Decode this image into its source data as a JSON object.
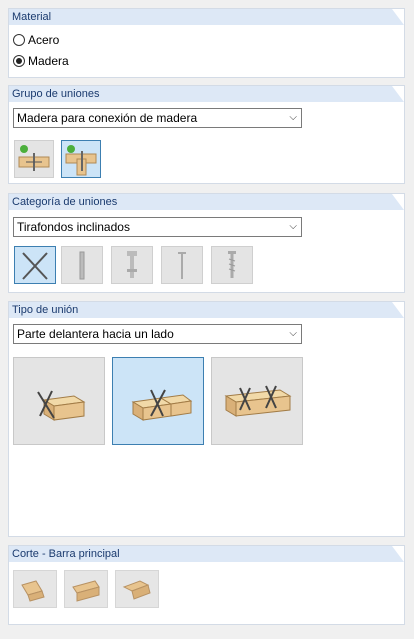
{
  "material": {
    "header": "Material",
    "options": [
      {
        "label": "Acero",
        "checked": false
      },
      {
        "label": "Madera",
        "checked": true
      }
    ]
  },
  "grupo": {
    "header": "Grupo de uniones",
    "selected": "Madera para conexión de madera",
    "icons": [
      "timber-to-timber-connection-icon",
      "timber-to-timber-cross-connection-icon"
    ],
    "selected_index": 1
  },
  "categoria": {
    "header": "Categoría de uniones",
    "selected": "Tirafondos inclinados",
    "icons": [
      "inclined-screws-icon",
      "dowel-icon",
      "bolt-icon",
      "nail-icon",
      "screw-icon"
    ],
    "selected_index": 0
  },
  "tipo": {
    "header": "Tipo de unión",
    "selected": "Parte delantera hacia un lado",
    "icons": [
      "end-joint-one-side-icon",
      "t-joint-crossed-screws-icon",
      "beam-joint-screws-icon"
    ],
    "selected_index": 1
  },
  "corte": {
    "header": "Corte - Barra principal",
    "icons": [
      "cut-variant-1-icon",
      "cut-variant-2-icon",
      "cut-variant-3-icon"
    ]
  },
  "colors": {
    "header_bg": "#dde8f6",
    "header_text": "#1a3a6e",
    "selected_bg": "#cce4f7",
    "selected_border": "#3c7fb1",
    "wood": "#e8c48e"
  }
}
